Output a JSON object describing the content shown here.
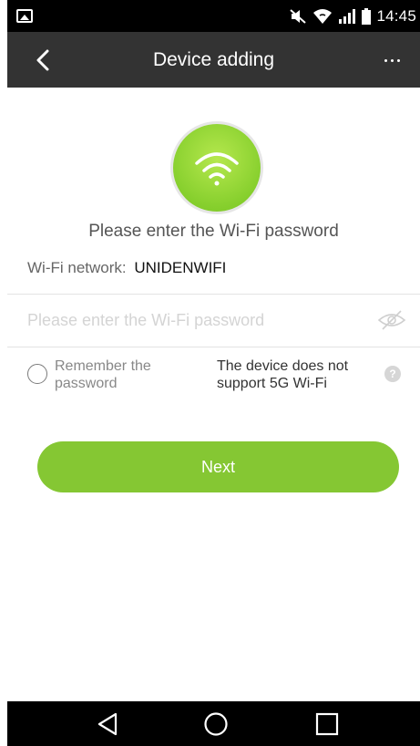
{
  "status_bar": {
    "time": "14:45",
    "icons": [
      "gallery-icon",
      "mute-icon",
      "wifi-icon",
      "signal-icon",
      "battery-icon"
    ]
  },
  "toolbar": {
    "title": "Device adding",
    "back_icon": "chevron-left-icon",
    "more_icon": "more-dots-icon"
  },
  "main": {
    "wifi_icon": "wifi-icon",
    "instruction": "Please enter the Wi-Fi password",
    "network_label": "Wi-Fi network:",
    "network_name": "UNIDENWIFI",
    "password": {
      "value": "",
      "placeholder": "Please enter the Wi-Fi password"
    },
    "visibility_icon": "eye-hidden-icon",
    "remember_label": "Remember the password",
    "remember_checked": false,
    "support_note": "The device does not support 5G Wi-Fi",
    "help_icon": "help-icon",
    "help_glyph": "?",
    "next_label": "Next"
  },
  "nav_bar": {
    "icons": [
      "nav-back-icon",
      "nav-home-icon",
      "nav-recent-icon"
    ]
  },
  "colors": {
    "accent": "#85c733",
    "toolbar": "#333333",
    "status_bar": "#000000",
    "wifi_circle": "#86cf2d"
  }
}
